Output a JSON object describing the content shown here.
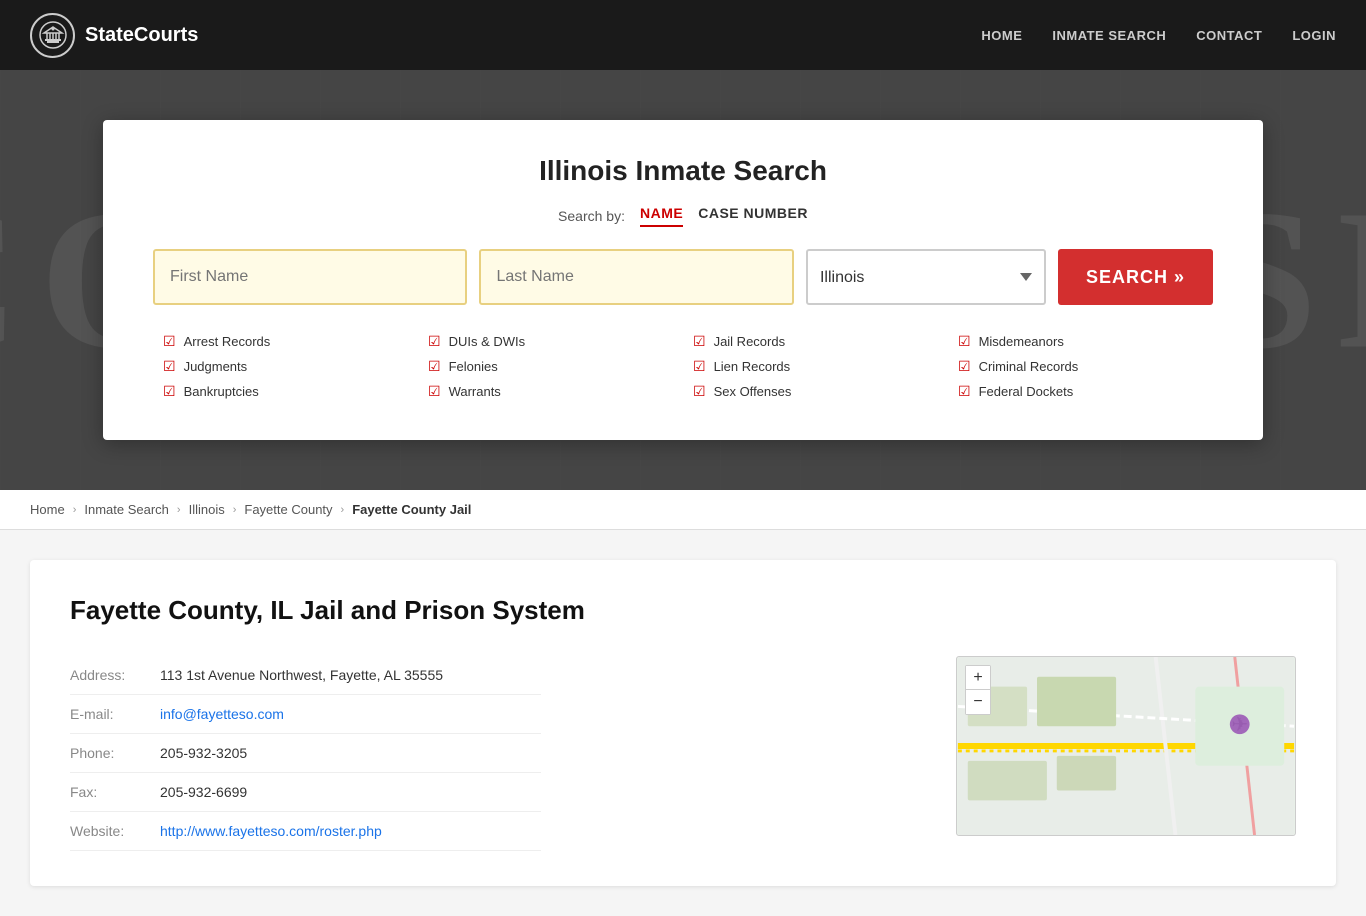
{
  "site": {
    "name": "StateCourts"
  },
  "nav": {
    "home": "HOME",
    "inmate_search": "INMATE SEARCH",
    "contact": "CONTACT",
    "login": "LOGIN"
  },
  "hero": {
    "background_text": "COURTHOUSE"
  },
  "search_card": {
    "title": "Illinois Inmate Search",
    "search_by_label": "Search by:",
    "tab_name": "NAME",
    "tab_case": "CASE NUMBER",
    "first_name_placeholder": "First Name",
    "last_name_placeholder": "Last Name",
    "state_value": "Illinois",
    "search_button": "SEARCH »",
    "checkboxes": [
      {
        "label": "Arrest Records"
      },
      {
        "label": "DUIs & DWIs"
      },
      {
        "label": "Jail Records"
      },
      {
        "label": "Misdemeanors"
      },
      {
        "label": "Judgments"
      },
      {
        "label": "Felonies"
      },
      {
        "label": "Lien Records"
      },
      {
        "label": "Criminal Records"
      },
      {
        "label": "Bankruptcies"
      },
      {
        "label": "Warrants"
      },
      {
        "label": "Sex Offenses"
      },
      {
        "label": "Federal Dockets"
      }
    ]
  },
  "breadcrumb": {
    "home": "Home",
    "inmate_search": "Inmate Search",
    "illinois": "Illinois",
    "fayette_county": "Fayette County",
    "current": "Fayette County Jail"
  },
  "facility": {
    "title": "Fayette County, IL Jail and Prison System",
    "address_label": "Address:",
    "address_value": "113 1st Avenue Northwest, Fayette, AL 35555",
    "email_label": "E-mail:",
    "email_value": "info@fayetteso.com",
    "phone_label": "Phone:",
    "phone_value": "205-932-3205",
    "fax_label": "Fax:",
    "fax_value": "205-932-6699",
    "website_label": "Website:",
    "website_value": "http://www.fayetteso.com/roster.php"
  }
}
